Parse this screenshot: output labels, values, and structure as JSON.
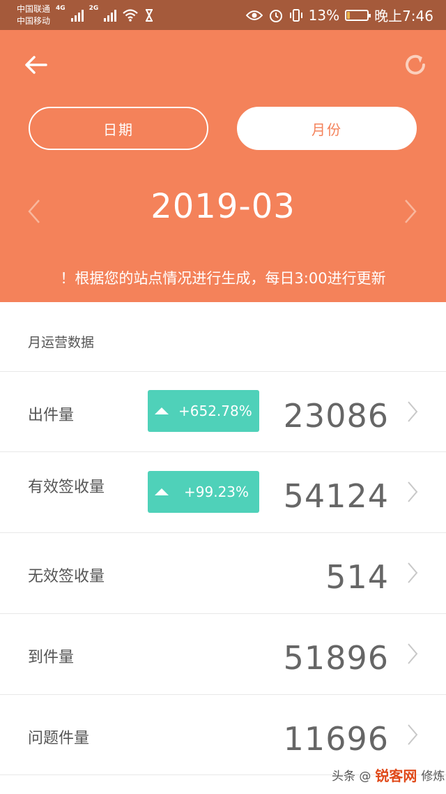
{
  "status_bar": {
    "carrier_1": "中国联通",
    "carrier_2": "中国移动",
    "net_1": "4G",
    "net_2": "2G",
    "battery_percent": "13%",
    "battery_level": 0.13,
    "time": "晚上7:46",
    "icons": [
      "signal-icon",
      "wifi-icon",
      "hourglass-icon",
      "eye-icon",
      "alarm-icon",
      "vibrate-icon",
      "battery-icon"
    ]
  },
  "header": {
    "back_icon": "arrow-left-icon",
    "refresh_icon": "refresh-icon",
    "tabs": [
      {
        "label": "日期",
        "selected": false
      },
      {
        "label": "月份",
        "selected": true
      }
    ],
    "period": "2019-03",
    "notice": "！根据您的站点情况进行生成，每日3:00进行更新"
  },
  "section": {
    "title": "月运营数据"
  },
  "metrics": [
    {
      "label": "出件量",
      "change": "+652.78%",
      "value": "23086"
    },
    {
      "label": "有效签收量",
      "change": "+99.23%",
      "value": "54124"
    },
    {
      "label": "无效签收量",
      "change": "",
      "value": "514"
    },
    {
      "label": "到件量",
      "change": "",
      "value": "51896"
    },
    {
      "label": "问题件量",
      "change": "",
      "value": "11696"
    }
  ],
  "colors": {
    "accent": "#f4825a",
    "status_bar": "#a55a3b",
    "badge": "#4fd1b9"
  },
  "watermark": {
    "text": "头条 @",
    "logo": "锐客网",
    "suffix": "修炼"
  }
}
